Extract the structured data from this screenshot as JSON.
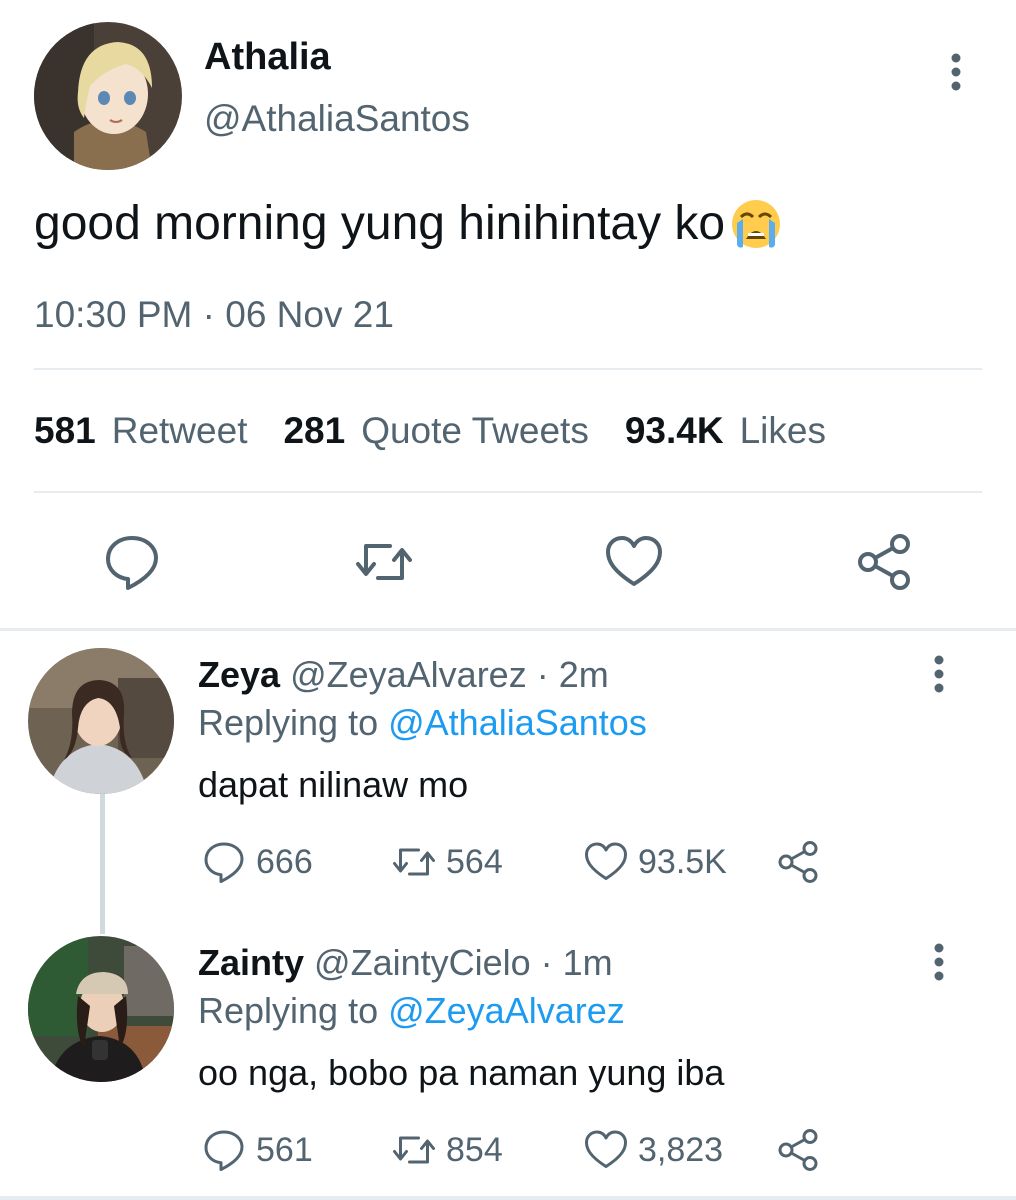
{
  "tweet": {
    "name": "Athalia",
    "handle": "@AthaliaSantos",
    "text": "good morning yung hinihintay ko",
    "emoji": "loudly-crying-face",
    "timestamp": "10:30 PM · 06 Nov 21",
    "stats": [
      {
        "count": "581",
        "label": "Retweet"
      },
      {
        "count": "281",
        "label": "Quote Tweets"
      },
      {
        "count": "93.4K",
        "label": "Likes"
      }
    ],
    "actions": [
      "reply-icon",
      "retweet-icon",
      "like-icon",
      "share-icon"
    ]
  },
  "replies": [
    {
      "name": "Zeya",
      "handle": "@ZeyaAlvarez",
      "time": "· 2m",
      "replying_prefix": "Replying to",
      "replying_to": "@AthaliaSantos",
      "text": "dapat nilinaw mo",
      "replies": "666",
      "retweets": "564",
      "likes": "93.5K"
    },
    {
      "name": "Zainty",
      "handle": "@ZaintyCielo",
      "time": "· 1m",
      "replying_prefix": "Replying to",
      "replying_to": "@ZeyaAlvarez",
      "text": "oo nga, bobo pa naman yung iba",
      "replies": "561",
      "retweets": "854",
      "likes": "3,823"
    }
  ],
  "colors": {
    "text": "#0f1419",
    "secondary": "#536471",
    "link": "#1d9bf0",
    "divider": "#e6ecf0"
  }
}
